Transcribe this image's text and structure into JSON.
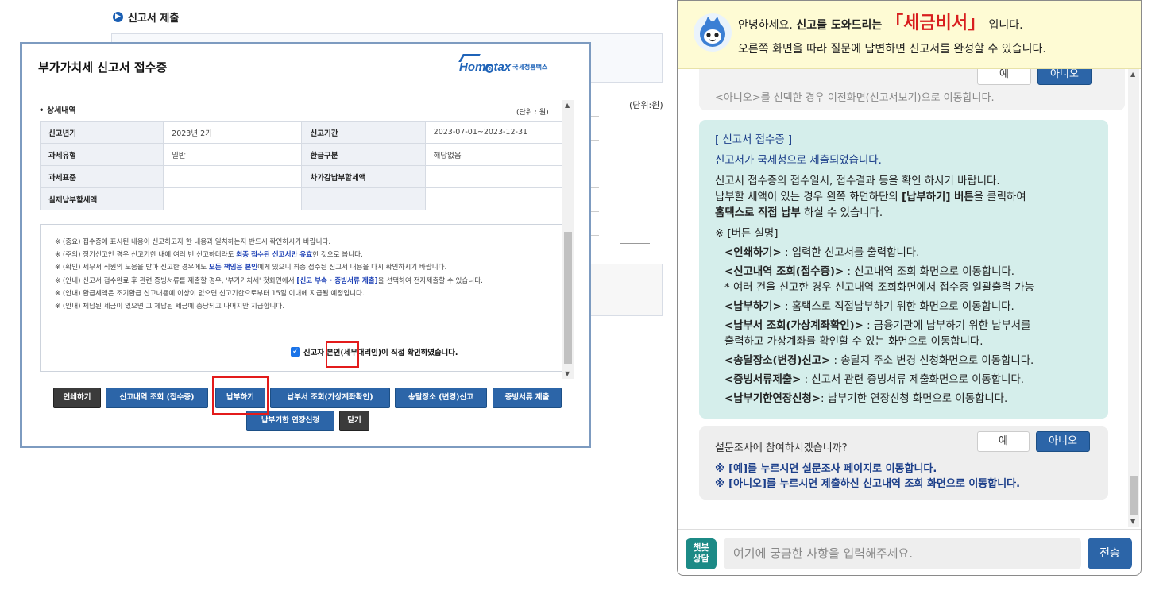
{
  "background": {
    "section_title": "신고서 제출",
    "unit": "(단위:원)"
  },
  "modal": {
    "title": "부가가치세 신고서 접수증",
    "logo": {
      "brand": "Hometax",
      "sub": "국세청홈택스",
      "tiny": "국세청 납세서비스"
    },
    "section_title": "상세내역",
    "unit": "(단위 : 원)",
    "rows": [
      {
        "h1": "신고년기",
        "v1": "2023년 2기",
        "h2": "신고기간",
        "v2": "2023-07-01~2023-12-31"
      },
      {
        "h1": "과세유형",
        "v1": "일반",
        "h2": "환급구분",
        "v2": "해당없음"
      },
      {
        "h1": "과세표준",
        "v1": "",
        "h2": "차가감납부할세액",
        "v2": ""
      },
      {
        "h1": "실제납부할세액",
        "v1": "",
        "h2": "",
        "v2": ""
      }
    ],
    "notes": {
      "n1": "※ (중요) 접수증에 표시된 내용이 신고하고자 한 내용과 일치하는지 반드시 확인하시기 바랍니다.",
      "n2_a": "※ (주의) 정기신고인 경우 신고기한 내에 여러 번 신고하더라도 ",
      "n2_hl": "최종 접수된 신고서만 유효",
      "n2_b": "한 것으로 봅니다.",
      "n3_a": "※ (확인) 세무서 직원의 도움을 받아 신고한 경우에도 ",
      "n3_hl": "모든 책임은 본인",
      "n3_b": "에게 있으니 최종 접수된 신고서 내용을 다시 확인하시기 바랍니다.",
      "n4_a": "※ (안내) 신고서 접수완료 후 관련 증빙서류를 제출할 경우, '부가가치세' 첫화면에서 ",
      "n4_hl": "[신고 부속 · 증빙서류 제출]",
      "n4_b": "을 선택하여 전자제출할 수 있습니다.",
      "n5": "※ (안내) 환급세액은 조기환급 신고내용에 이상이 없으면 신고기한으로부터 15일 이내에 지급될 예정입니다.",
      "n6": "※ (안내) 체납된 세금이 있으면 그 체납된 세금에 충당되고 나머지만 지급합니다."
    },
    "confirm_label": "신고자 본인(세무대리인)이 직접 확인하였습니다.",
    "buttons": {
      "print": "인쇄하기",
      "history": "신고내역 조회 (접수증)",
      "pay": "납부하기",
      "bill": "납부서 조회(가상계좌확인)",
      "address": "송달장소 (변경)신고",
      "evidence": "증빙서류 제출",
      "extension": "납부기한 연장신청",
      "close": "닫기"
    }
  },
  "chat": {
    "greet_a": "안녕하세요. ",
    "greet_b": "신고를 도와드리는 ",
    "brand": "「세금비서」",
    "greet_c": " 입니다.",
    "greet_line2": "오른쪽 화면을 따라 질문에 답변하면 신고서를 완성할 수 있습니다.",
    "top_yes": "예",
    "top_no": "아니오",
    "top_note": "<아니오>를 선택한 경우 이전화면(신고서보기)으로 이동합니다.",
    "receipt": {
      "title": "[ 신고서 접수증 ]",
      "submitted": "신고서가 국세청으로 제출되었습니다.",
      "p1": "신고서 접수증의 접수일시, 접수결과 등을 확인 하시기 바랍니다.",
      "p2_a": "납부할 세액이 있는 경우 왼쪽 화면하단의 ",
      "p2_b": "[납부하기] 버튼",
      "p2_c": "을 클릭하여",
      "p3_a": "홈택스로 직접 납부",
      "p3_b": " 하실 수 있습니다.",
      "btn_desc_title": "※ [버튼 설명]",
      "items": [
        {
          "k": "<인쇄하기>",
          "d": " : 입력한 신고서를 출력합니다."
        },
        {
          "k": "<신고내역 조회(접수증)>",
          "d": " : 신고내역 조회 화면으로 이동합니다."
        },
        {
          "k": "<납부하기>",
          "d": " : 홈택스로 직접납부하기 위한 화면으로 이동합니다."
        },
        {
          "k": "<납부서 조회(가상계좌확인)>",
          "d": " : 금융기관에 납부하기 위한 납부서를"
        },
        {
          "k": "<송달장소(변경)신고>",
          "d": " : 송달지 주소 변경 신청화면으로 이동합니다."
        },
        {
          "k": "<증빙서류제출>",
          "d": " : 신고서 관련 증빙서류 제출화면으로 이동합니다."
        },
        {
          "k": "<납부기한연장신청>",
          "d": ": 납부기한 연장신청 화면으로 이동합니다."
        }
      ],
      "history_sub": "* 여러 건을 신고한 경우 신고내역 조회화면에서 접수증 일괄출력 가능",
      "bill_sub": "출력하고 가상계좌를 확인할 수 있는 화면으로 이동합니다."
    },
    "survey": {
      "question": "설문조사에 참여하시겠습니까?",
      "yes": "예",
      "no": "아니오",
      "note1": "※ [예]를 누르시면 설문조사 페이지로 이동합니다.",
      "note2": "※ [아니오]를 누르시면 제출하신 신고내역 조회 화면으로 이동합니다."
    },
    "bot_label_1": "챗봇",
    "bot_label_2": "상담",
    "input_placeholder": "여기에 궁금한 사항을 입력해주세요.",
    "send": "전송"
  }
}
